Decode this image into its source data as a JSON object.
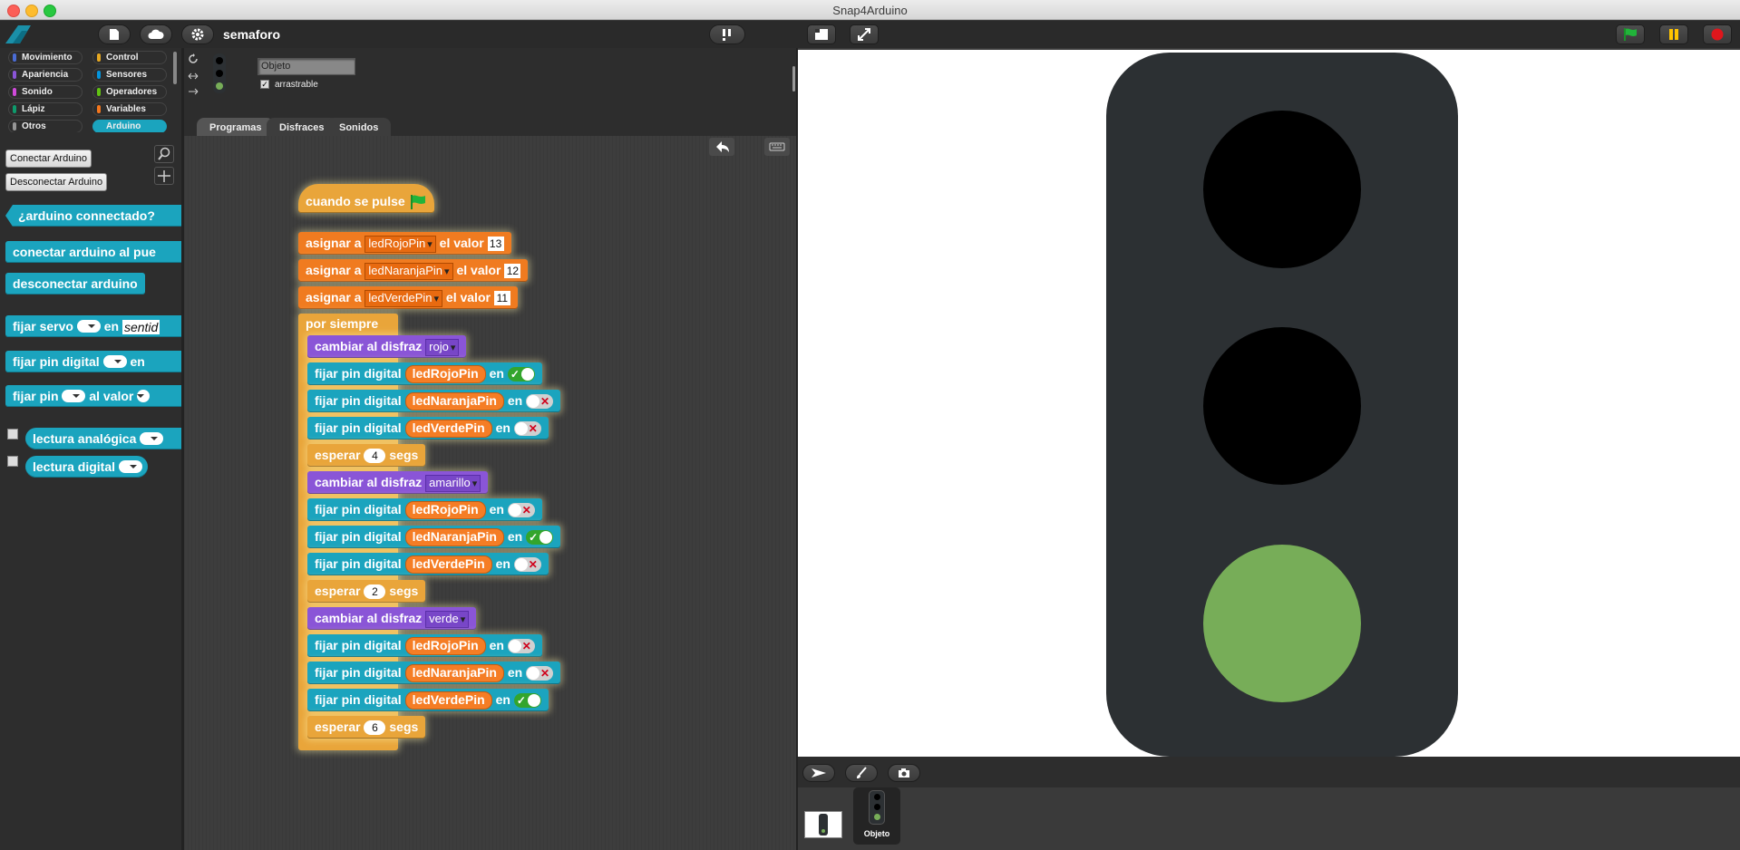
{
  "window": {
    "title": "Snap4Arduino"
  },
  "toolbar": {
    "project_name": "semaforo"
  },
  "categories": [
    {
      "label": "Movimiento",
      "color": "#4a6cd4"
    },
    {
      "label": "Control",
      "color": "#e6a822"
    },
    {
      "label": "Apariencia",
      "color": "#8a55d7"
    },
    {
      "label": "Sensores",
      "color": "#0494dc"
    },
    {
      "label": "Sonido",
      "color": "#cf4ad9"
    },
    {
      "label": "Operadores",
      "color": "#62c213"
    },
    {
      "label": "Lápiz",
      "color": "#0e9a6c"
    },
    {
      "label": "Variables",
      "color": "#f3761d"
    },
    {
      "label": "Otros",
      "color": "#969696"
    },
    {
      "label": "Arduino",
      "color": "#1ba4be"
    }
  ],
  "palette": {
    "connect_button": "Conectar Arduino",
    "disconnect_button": "Desconectar Arduino",
    "blocks": {
      "connected": "¿arduino connectado?",
      "connect_port": "conectar arduino al pue",
      "disconnect": "desconectar arduino",
      "servo_a": "fijar servo",
      "servo_en": "en",
      "servo_value": "sentid",
      "digital_a": "fijar pin digital",
      "digital_en": "en",
      "pin_a": "fijar pin",
      "pin_b": "al valor",
      "analog_read": "lectura analógica",
      "digital_read": "lectura digital"
    }
  },
  "sprite": {
    "name_value": "Objeto",
    "draggable_label": "arrastrable",
    "draggable": true
  },
  "tabs": [
    "Programas",
    "Disfraces",
    "Sonidos"
  ],
  "script": {
    "hat": "cuando se pulse",
    "kw_set": "asignar a",
    "kw_value": "el valor",
    "kw_forever": "por siempre",
    "kw_costume": "cambiar al disfraz",
    "kw_digital": "fijar pin digital",
    "kw_en": "en",
    "kw_wait": "esperar",
    "kw_secs": "segs",
    "vars": [
      {
        "name": "ledRojoPin",
        "value": "13"
      },
      {
        "name": "ledNaranjaPin",
        "value": "12"
      },
      {
        "name": "ledVerdePin",
        "value": "11"
      }
    ],
    "phases": [
      {
        "costume": "rojo",
        "pins": [
          true,
          false,
          false
        ],
        "wait": "4"
      },
      {
        "costume": "amarillo",
        "pins": [
          false,
          true,
          false
        ],
        "wait": "2"
      },
      {
        "costume": "verde",
        "pins": [
          false,
          false,
          true
        ],
        "wait": "6"
      }
    ]
  },
  "stage": {
    "lights": [
      {
        "name": "red",
        "color": "#000000"
      },
      {
        "name": "amber",
        "color": "#000000"
      },
      {
        "name": "green",
        "color": "#77ad58"
      }
    ],
    "housing_color": "#2c3033"
  },
  "corral": {
    "sprite_label": "Objeto"
  }
}
